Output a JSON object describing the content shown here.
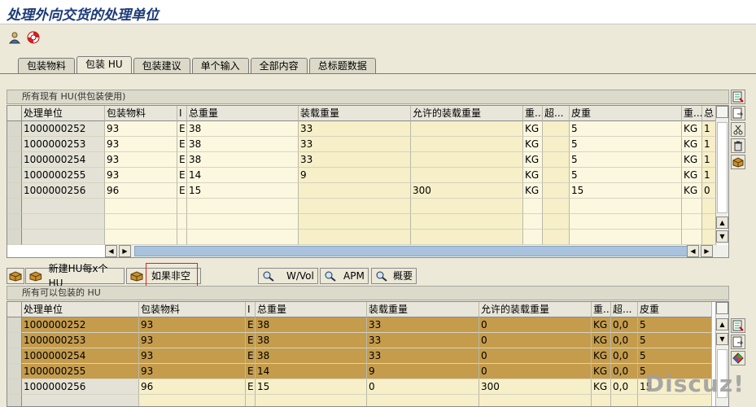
{
  "title": "处理外向交货的处理单位",
  "tabs": [
    "包装物料",
    "包装 HU",
    "包装建议",
    "单个输入",
    "全部内容",
    "总标题数据"
  ],
  "active_tab": 1,
  "upper": {
    "title": "所有现有 HU(供包装使用)",
    "columns": [
      "处理单位",
      "包装物料",
      "I",
      "总重量",
      "装载重量",
      "允许的装载重量",
      "重...",
      "超...",
      "皮重",
      "重...",
      "总"
    ],
    "rows": [
      [
        "1000000252",
        "93",
        "E",
        "38",
        "33",
        "",
        "KG",
        "",
        "5",
        "KG",
        "1"
      ],
      [
        "1000000253",
        "93",
        "E",
        "38",
        "33",
        "",
        "KG",
        "",
        "5",
        "KG",
        "1"
      ],
      [
        "1000000254",
        "93",
        "E",
        "38",
        "33",
        "",
        "KG",
        "",
        "5",
        "KG",
        "1"
      ],
      [
        "1000000255",
        "93",
        "E",
        "14",
        "9",
        "",
        "KG",
        "",
        "5",
        "KG",
        "1"
      ],
      [
        "1000000256",
        "96",
        "E",
        "15",
        "",
        "300",
        "KG",
        "",
        "15",
        "KG",
        "0"
      ]
    ]
  },
  "toolbar": {
    "new_hu_label": "新建HU每x个HU",
    "if_not_empty_label": "如果非空",
    "wvol_label": "W/Vol",
    "apm_label": "APM",
    "summary_label": "概要"
  },
  "lower": {
    "title": "所有可以包装的 HU",
    "columns": [
      "处理单位",
      "包装物料",
      "I",
      "总重量",
      "装载重量",
      "允许的装载重量",
      "重...",
      "超...",
      "皮重"
    ],
    "rows": [
      [
        "1000000252",
        "93",
        "E",
        "38",
        "33",
        "0",
        "KG",
        "0,0",
        "5"
      ],
      [
        "1000000253",
        "93",
        "E",
        "38",
        "33",
        "0",
        "KG",
        "0,0",
        "5"
      ],
      [
        "1000000254",
        "93",
        "E",
        "38",
        "33",
        "0",
        "KG",
        "0,0",
        "5"
      ],
      [
        "1000000255",
        "93",
        "E",
        "14",
        "9",
        "0",
        "KG",
        "0,0",
        "5"
      ],
      [
        "1000000256",
        "96",
        "E",
        "15",
        "0",
        "300",
        "KG",
        "0,0",
        "15"
      ]
    ]
  },
  "watermark": "Discuz!"
}
